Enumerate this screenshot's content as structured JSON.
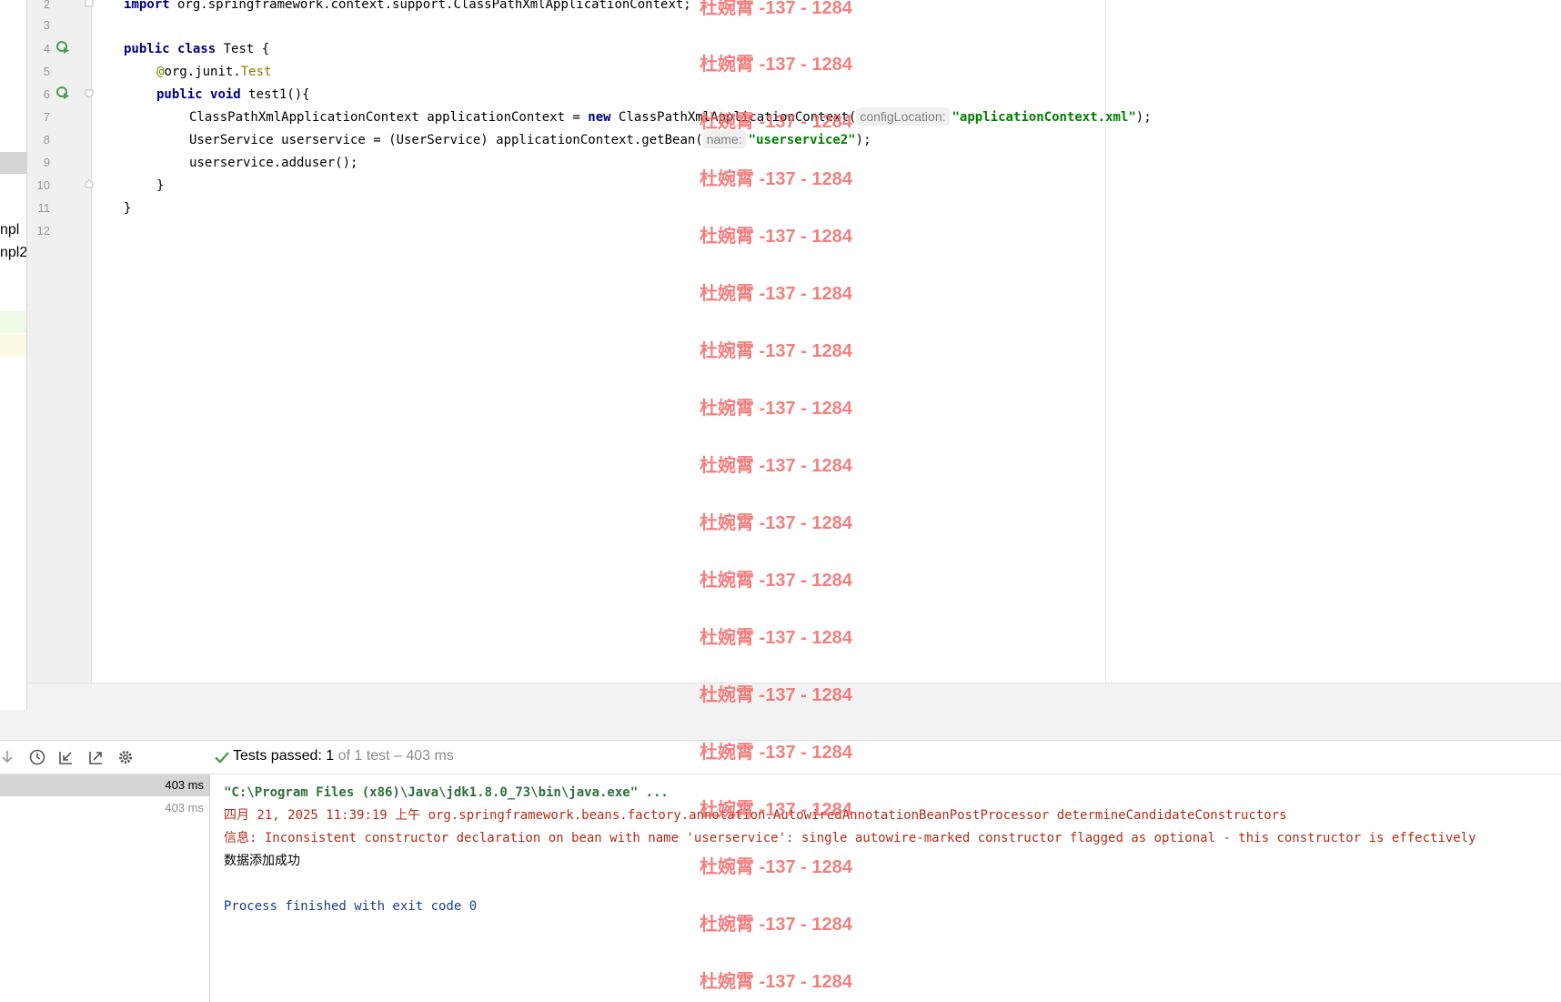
{
  "project_tree": {
    "items": [
      "npl",
      "npl2"
    ]
  },
  "editor": {
    "line_numbers": [
      "2",
      "3",
      "4",
      "5",
      "6",
      "7",
      "8",
      "9",
      "10",
      "11",
      "12"
    ],
    "lines": {
      "l2": {
        "kw": "import",
        "rest": " org.springframework.context.support.ClassPathXmlApplicationContext;"
      },
      "l4": {
        "kw1": "public",
        "kw2": "class",
        "rest": " Test {"
      },
      "l5": {
        "ann1": "@",
        "mid": "org.junit.",
        "ann2": "Test"
      },
      "l6": {
        "kw1": "public",
        "kw2": "void",
        "rest": " test1(){"
      },
      "l7": {
        "pre": "ClassPathXmlApplicationContext applicationContext = ",
        "kw": "new",
        "mid": " ClassPathXmlApplicationContext(",
        "hint": "configLocation:",
        "str": "\"applicationContext.xml\"",
        "end": ");"
      },
      "l8": {
        "pre": "UserService userservice = (UserService) applicationContext.getBean(",
        "hint": "name:",
        "str": "\"userservice2\"",
        "end": ");"
      },
      "l9": {
        "text": "userservice.adduser();"
      },
      "l10": {
        "text": "}"
      },
      "l11": {
        "text": "}"
      }
    }
  },
  "run_panel": {
    "status_label": "Tests passed:",
    "status_count": "1",
    "status_detail": "of 1 test – 403 ms",
    "tree_rows": [
      {
        "duration": "403 ms"
      },
      {
        "duration": "403 ms"
      }
    ],
    "console_lines": [
      "\"C:\\Program Files (x86)\\Java\\jdk1.8.0_73\\bin\\java.exe\" ...",
      "四月 21, 2025 11:39:19 上午 org.springframework.beans.factory.annotation.AutowiredAnnotationBeanPostProcessor determineCandidateConstructors",
      "信息: Inconsistent constructor declaration on bean with name 'userservice': single autowire-marked constructor flagged as optional - this constructor is effectively",
      "数据添加成功",
      "",
      "Process finished with exit code 0"
    ]
  },
  "watermark": {
    "text": "杜婉霄 -137 - 1284"
  },
  "colors": {
    "keyword": "#000080",
    "string": "#008000",
    "annotation": "#808000",
    "error_text": "#b32d1c",
    "pass_green": "#499c54",
    "watermark": "#f06a6a"
  }
}
